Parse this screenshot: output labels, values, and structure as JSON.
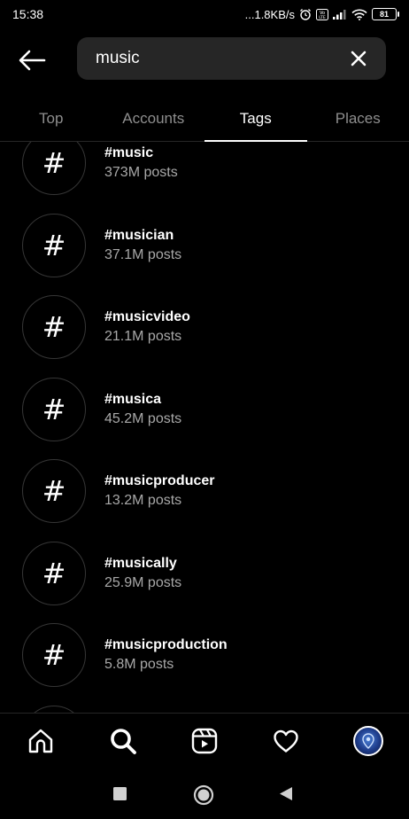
{
  "status_bar": {
    "time": "15:38",
    "network_speed": "...1.8KB/s",
    "battery_level": "81",
    "icons": [
      "alarm-icon",
      "volte-icon",
      "signal-icon",
      "wifi-icon",
      "battery-icon"
    ]
  },
  "search": {
    "query": "music",
    "back_icon": "arrow-left-icon",
    "clear_icon": "close-icon"
  },
  "tabs": [
    {
      "label": "Top",
      "active": false
    },
    {
      "label": "Accounts",
      "active": false
    },
    {
      "label": "Tags",
      "active": true
    },
    {
      "label": "Places",
      "active": false
    }
  ],
  "results": [
    {
      "symbol": "#",
      "tag": "#music",
      "count": "373M posts"
    },
    {
      "symbol": "#",
      "tag": "#musician",
      "count": "37.1M posts"
    },
    {
      "symbol": "#",
      "tag": "#musicvideo",
      "count": "21.1M posts"
    },
    {
      "symbol": "#",
      "tag": "#musica",
      "count": "45.2M posts"
    },
    {
      "symbol": "#",
      "tag": "#musicproducer",
      "count": "13.2M posts"
    },
    {
      "symbol": "#",
      "tag": "#musically",
      "count": "25.9M posts"
    },
    {
      "symbol": "#",
      "tag": "#musicproduction",
      "count": "5.8M posts"
    }
  ],
  "bottom_nav": [
    "home-icon",
    "search-icon",
    "reels-icon",
    "heart-icon",
    "profile-avatar"
  ],
  "system_nav": [
    "recents-square-icon",
    "home-circle-icon",
    "back-triangle-icon"
  ],
  "colors": {
    "background": "#000000",
    "search_box": "#262626",
    "secondary_text": "#a8a8a8",
    "inactive_tab": "#8e8e8e"
  }
}
